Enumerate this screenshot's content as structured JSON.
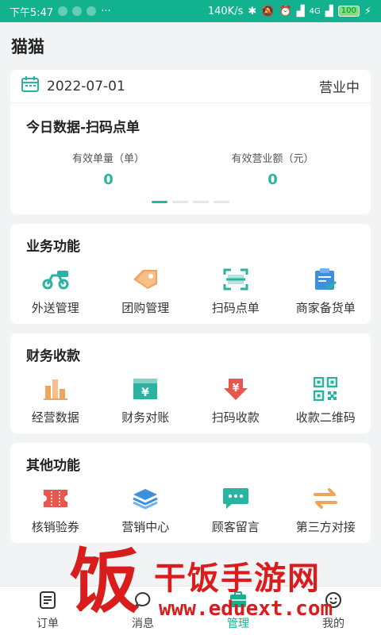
{
  "status_bar": {
    "time": "下午5:47",
    "network_speed": "140K/s",
    "network_type": "4G",
    "battery": "100"
  },
  "header": {
    "title": "猫猫"
  },
  "summary": {
    "date": "2022-07-01",
    "status": "营业中",
    "title": "今日数据-扫码点单",
    "stats": [
      {
        "label": "有效单量（单）",
        "value": "0"
      },
      {
        "label": "有效营业额（元）",
        "value": "0"
      }
    ],
    "pager": {
      "pages": 4,
      "active": 0
    }
  },
  "sections": [
    {
      "title": "业务功能",
      "items": [
        {
          "label": "外送管理",
          "icon": "scooter-icon"
        },
        {
          "label": "团购管理",
          "icon": "tag-icon"
        },
        {
          "label": "扫码点单",
          "icon": "scan-icon"
        },
        {
          "label": "商家备货单",
          "icon": "clipboard-icon"
        }
      ]
    },
    {
      "title": "财务收款",
      "items": [
        {
          "label": "经营数据",
          "icon": "bar-chart-icon"
        },
        {
          "label": "财务对账",
          "icon": "ledger-icon"
        },
        {
          "label": "扫码收款",
          "icon": "yuan-down-icon"
        },
        {
          "label": "收款二维码",
          "icon": "qrcode-icon"
        }
      ]
    },
    {
      "title": "其他功能",
      "items": [
        {
          "label": "核销验券",
          "icon": "ticket-icon"
        },
        {
          "label": "营销中心",
          "icon": "layers-icon"
        },
        {
          "label": "顾客留言",
          "icon": "chat-icon"
        },
        {
          "label": "第三方对接",
          "icon": "swap-icon"
        }
      ]
    }
  ],
  "tabbar": [
    {
      "label": "订单",
      "icon": "order-icon"
    },
    {
      "label": "消息",
      "icon": "message-icon"
    },
    {
      "label": "管理",
      "icon": "manage-icon",
      "active": true
    },
    {
      "label": "我的",
      "icon": "profile-icon"
    }
  ],
  "watermark": {
    "char": "饭",
    "text": "干饭手游网",
    "url": "www.eduext.com"
  },
  "colors": {
    "accent": "#13b28f",
    "value": "#2ab3a0",
    "watermark": "#d91c1c"
  }
}
